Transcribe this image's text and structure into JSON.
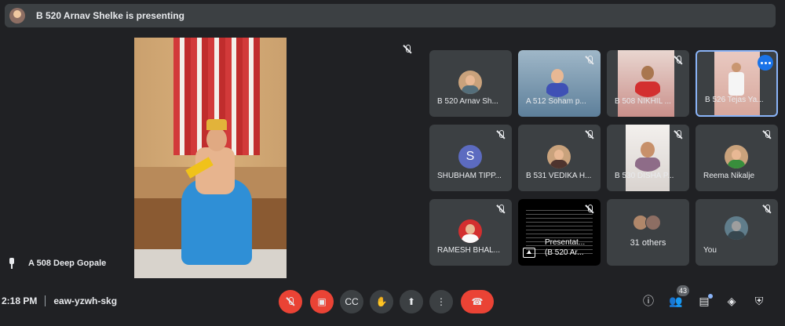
{
  "top_banner": {
    "text": "B 520 Arnav Shelke is presenting"
  },
  "stage": {
    "pinned_name": "A 508 Deep Gopale"
  },
  "tiles": [
    {
      "name": "B 520 Arnav Sh..."
    },
    {
      "name": "A 512 Soham p..."
    },
    {
      "name": "B 508 NIKHIL ..."
    },
    {
      "name": "B 526 Tejas Ya..."
    },
    {
      "name": "SHUBHAM TIPP...",
      "initial": "S"
    },
    {
      "name": "B 531 VEDIKA H..."
    },
    {
      "name": "B 530 DISHA P..."
    },
    {
      "name": "Reema Nikalje"
    },
    {
      "name": "RAMESH BHAL..."
    },
    {
      "name_line1": "Presentat...",
      "name_line2": "(B 520 Ar..."
    },
    {
      "name": "31 others"
    },
    {
      "name": "You"
    }
  ],
  "meeting": {
    "time": "2:18 PM",
    "code": "eaw-yzwh-skg"
  },
  "people_count": "43",
  "colors": {
    "background": "#202124",
    "tile": "#3c4043",
    "danger": "#ea4335",
    "accent": "#1a73e8"
  },
  "icons": [
    "mic-off-icon",
    "camera-off-icon",
    "captions-icon",
    "raise-hand-icon",
    "present-icon",
    "more-options-icon",
    "end-call-icon",
    "info-icon",
    "people-icon",
    "chat-icon",
    "activities-icon",
    "host-controls-icon"
  ]
}
